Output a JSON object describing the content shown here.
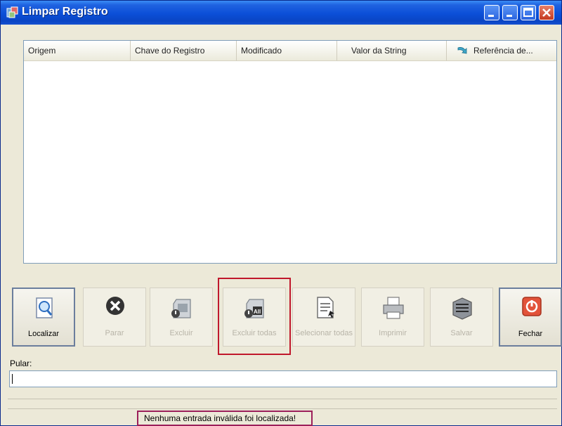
{
  "window": {
    "title": "Limpar Registro"
  },
  "list": {
    "columns": [
      "Origem",
      "Chave do Registro",
      "Modificado",
      "Valor da String",
      "Referência de..."
    ]
  },
  "toolbar": {
    "buttons": [
      {
        "label": "Localizar",
        "icon": "search-document-icon",
        "state": "enabled"
      },
      {
        "label": "Parar",
        "icon": "stop-x-icon",
        "state": "enabled"
      },
      {
        "label": "Excluir",
        "icon": "delete-registry-icon",
        "state": "disabled"
      },
      {
        "label": "Excluir todas",
        "icon": "delete-all-registry-icon",
        "state": "disabled"
      },
      {
        "label": "Selecionar todas",
        "icon": "select-all-icon",
        "state": "disabled"
      },
      {
        "label": "Imprimir",
        "icon": "printer-icon",
        "state": "disabled"
      },
      {
        "label": "Salvar",
        "icon": "save-icon",
        "state": "disabled"
      },
      {
        "label": "Fechar",
        "icon": "power-icon",
        "state": "enabled"
      }
    ]
  },
  "skip": {
    "label": "Pular:",
    "value": ""
  },
  "status": {
    "message": "Nenhuma entrada inválida foi localizada!"
  },
  "colors": {
    "title_bar": "#0b4fd8",
    "highlight": "#c0182c"
  }
}
